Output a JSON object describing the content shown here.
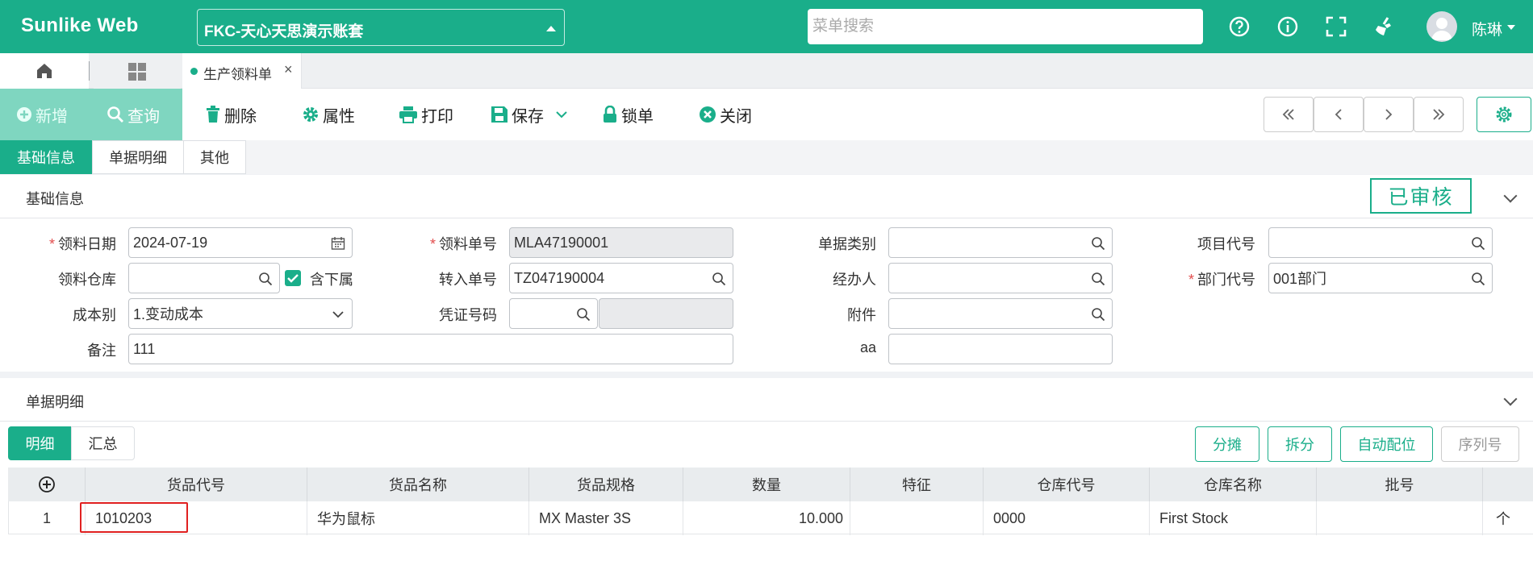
{
  "app": {
    "logo": "Sunlike Web",
    "account": "FKC-天心天思演示账套",
    "search_placeholder": "菜单搜索",
    "user": "陈琳"
  },
  "tabs": {
    "doc_tab": "生产领料单",
    "close": "×"
  },
  "toolbar": {
    "new": "新增",
    "query": "查询",
    "delete": "删除",
    "properties": "属性",
    "print": "打印",
    "save": "保存",
    "lock": "锁单",
    "close": "关闭"
  },
  "section_tabs": [
    "基础信息",
    "单据明细",
    "其他"
  ],
  "basic": {
    "title": "基础信息",
    "status": "已审核",
    "fields": {
      "date_label": "领料日期",
      "date_value": "2024-07-19",
      "order_no_label": "领料单号",
      "order_no_value": "MLA47190001",
      "doc_type_label": "单据类别",
      "doc_type_value": "",
      "project_label": "项目代号",
      "project_value": "",
      "warehouse_label": "领料仓库",
      "warehouse_value": "",
      "include_sub_label": "含下属",
      "transfer_label": "转入单号",
      "transfer_value": "TZ047190004",
      "handler_label": "经办人",
      "handler_value": "",
      "dept_label": "部门代号",
      "dept_value": "001部门",
      "cost_type_label": "成本别",
      "cost_type_value": "1.变动成本",
      "voucher_label": "凭证号码",
      "voucher_value": "",
      "attachment_label": "附件",
      "attachment_value": "",
      "remark_label": "备注",
      "remark_value": "111",
      "aa_label": "aa",
      "aa_value": ""
    }
  },
  "detail": {
    "title": "单据明细",
    "subtabs": [
      "明细",
      "汇总"
    ],
    "actions": [
      "分摊",
      "拆分",
      "自动配位",
      "序列号"
    ],
    "columns": [
      "货品代号",
      "货品名称",
      "货品规格",
      "数量",
      "特征",
      "仓库代号",
      "仓库名称",
      "批号"
    ],
    "rows": [
      {
        "seq": "1",
        "code": "1010203",
        "name": "华为鼠标",
        "spec": "MX Master 3S",
        "qty": "10.000",
        "feature": "",
        "wh_code": "0000",
        "wh_name": "First Stock",
        "batch": "",
        "extra": "个"
      }
    ]
  },
  "colors": {
    "primary": "#1aae8a",
    "primary_light": "#7fd6c0",
    "required": "#e24d4d",
    "highlight": "#e02020"
  }
}
